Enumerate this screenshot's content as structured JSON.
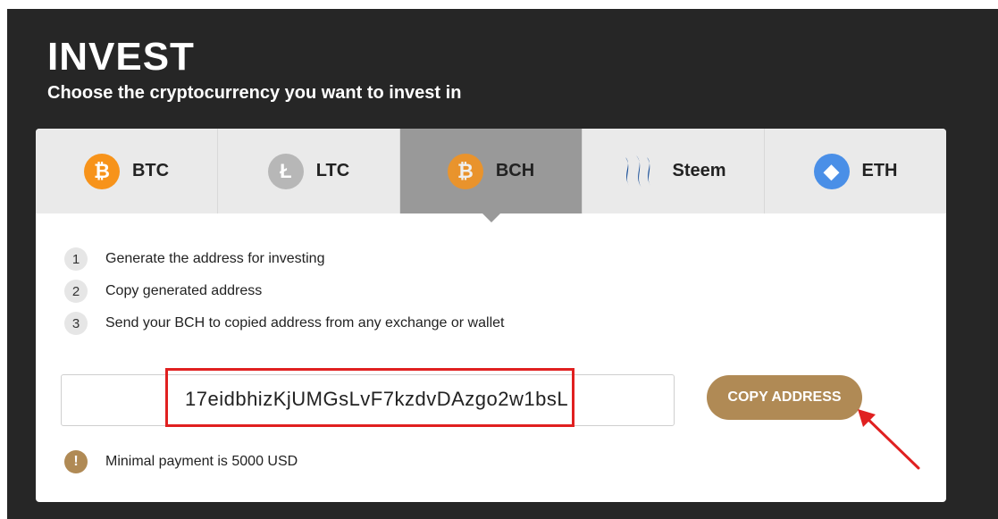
{
  "header": {
    "title": "INVEST",
    "subtitle": "Choose the cryptocurrency you want to invest in"
  },
  "tabs": [
    {
      "label": "BTC",
      "icon": "bitcoin-icon",
      "glyph": "₿",
      "active": false
    },
    {
      "label": "LTC",
      "icon": "litecoin-icon",
      "glyph": "Ł",
      "active": false
    },
    {
      "label": "BCH",
      "icon": "bitcoin-cash-icon",
      "glyph": "₿",
      "active": true
    },
    {
      "label": "Steem",
      "icon": "steem-icon",
      "active": false
    },
    {
      "label": "ETH",
      "icon": "ethereum-icon",
      "glyph": "◆",
      "active": false
    }
  ],
  "steps": [
    {
      "num": "1",
      "text": "Generate the address for investing"
    },
    {
      "num": "2",
      "text": "Copy generated address"
    },
    {
      "num": "3",
      "text": "Send your BCH to copied address from any exchange or wallet"
    }
  ],
  "address": {
    "value": "17eidbhizKjUMGsLvF7kzdvDAzgo2w1bsL"
  },
  "copy_button": {
    "label": "COPY ADDRESS"
  },
  "warning": {
    "glyph": "!",
    "text": "Minimal payment is 5000 USD"
  },
  "colors": {
    "background_dark": "#262626",
    "accent_gold": "#b08a55",
    "btc_orange": "#f7931a",
    "eth_blue": "#4a8fe7",
    "steem_blue": "#1a5099",
    "annotation_red": "#e02020"
  }
}
